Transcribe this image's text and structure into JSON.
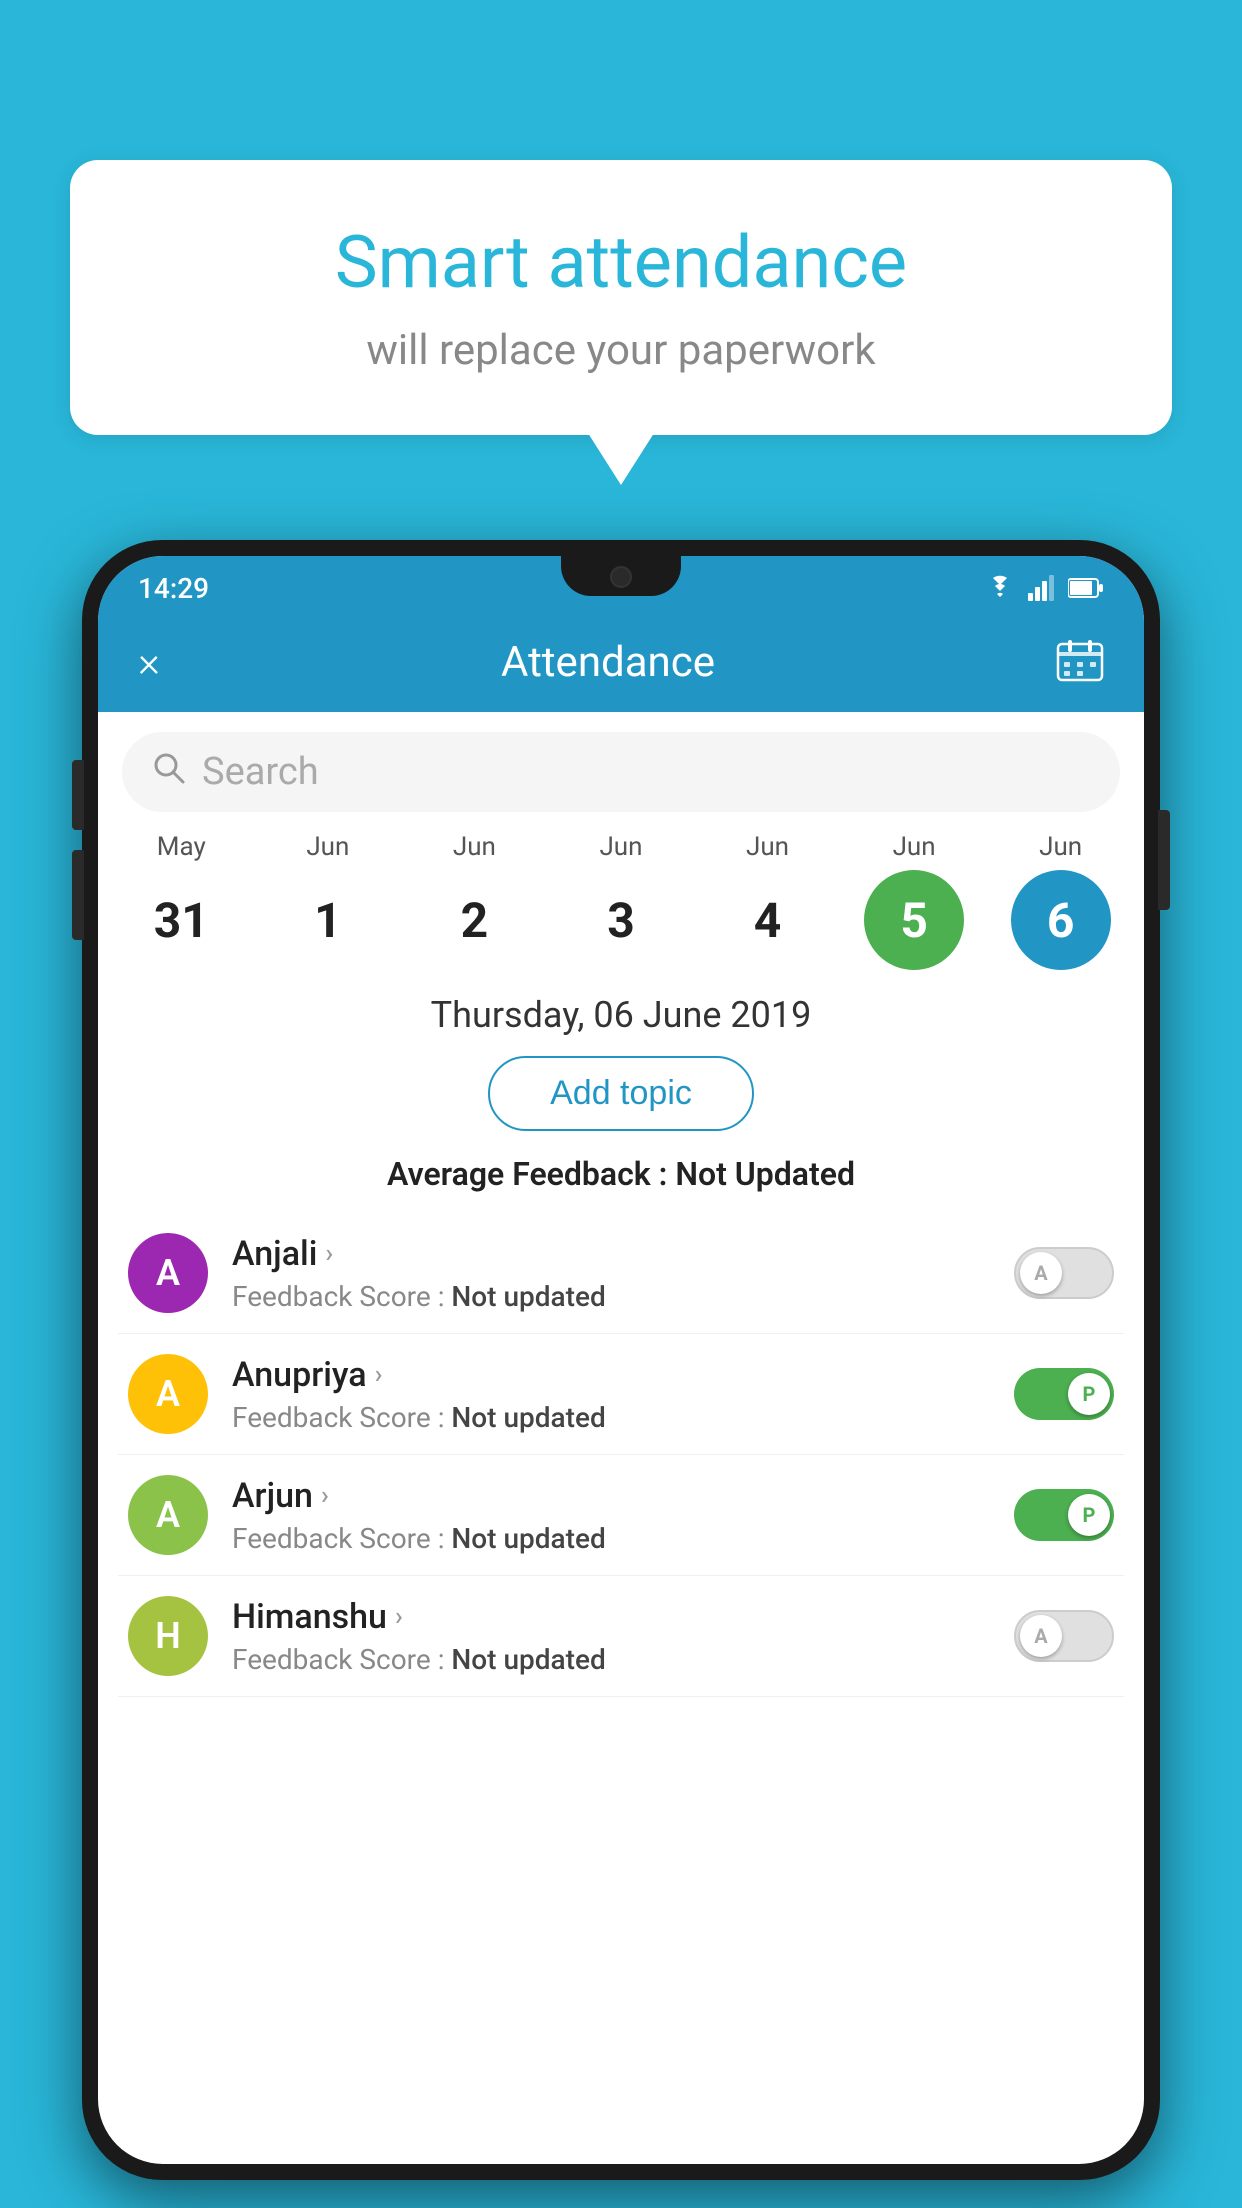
{
  "background_color": "#29b6d8",
  "speech_bubble": {
    "title": "Smart attendance",
    "subtitle": "will replace your paperwork"
  },
  "status_bar": {
    "time": "14:29",
    "icons": [
      "wifi",
      "signal",
      "battery"
    ]
  },
  "app_header": {
    "title": "Attendance",
    "close_label": "×",
    "calendar_icon": "📅"
  },
  "search": {
    "placeholder": "Search"
  },
  "calendar": {
    "days": [
      {
        "month": "May",
        "day": "31",
        "style": "normal"
      },
      {
        "month": "Jun",
        "day": "1",
        "style": "normal"
      },
      {
        "month": "Jun",
        "day": "2",
        "style": "normal"
      },
      {
        "month": "Jun",
        "day": "3",
        "style": "normal"
      },
      {
        "month": "Jun",
        "day": "4",
        "style": "normal"
      },
      {
        "month": "Jun",
        "day": "5",
        "style": "green"
      },
      {
        "month": "Jun",
        "day": "6",
        "style": "blue"
      }
    ]
  },
  "selected_date": "Thursday, 06 June 2019",
  "add_topic_label": "Add topic",
  "avg_feedback_label": "Average Feedback : ",
  "avg_feedback_value": "Not Updated",
  "students": [
    {
      "name": "Anjali",
      "avatar_letter": "A",
      "avatar_color": "#9c27b0",
      "feedback_label": "Feedback Score : ",
      "feedback_value": "Not updated",
      "toggle": "off",
      "toggle_letter": "A"
    },
    {
      "name": "Anupriya",
      "avatar_letter": "A",
      "avatar_color": "#ffc107",
      "feedback_label": "Feedback Score : ",
      "feedback_value": "Not updated",
      "toggle": "on",
      "toggle_letter": "P"
    },
    {
      "name": "Arjun",
      "avatar_letter": "A",
      "avatar_color": "#8bc34a",
      "feedback_label": "Feedback Score : ",
      "feedback_value": "Not updated",
      "toggle": "on",
      "toggle_letter": "P"
    },
    {
      "name": "Himanshu",
      "avatar_letter": "H",
      "avatar_color": "#a5c340",
      "feedback_label": "Feedback Score : ",
      "feedback_value": "Not updated",
      "toggle": "off",
      "toggle_letter": "A"
    }
  ]
}
